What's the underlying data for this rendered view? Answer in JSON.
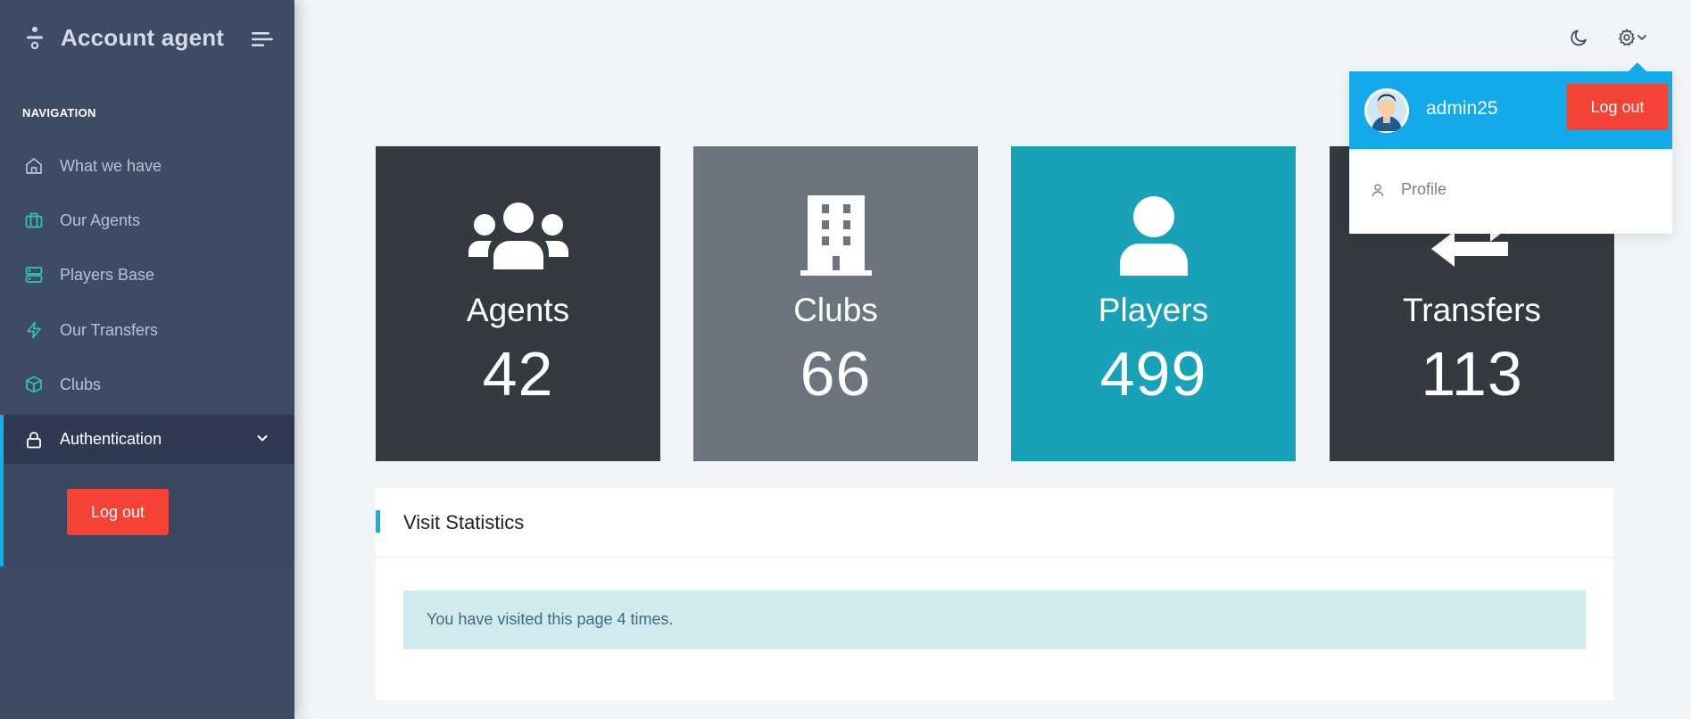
{
  "app": {
    "title": "Account agent"
  },
  "sidebar": {
    "heading": "NAVIGATION",
    "items": [
      {
        "label": "What we have",
        "icon": "home-icon"
      },
      {
        "label": "Our Agents",
        "icon": "briefcase-icon"
      },
      {
        "label": "Players Base",
        "icon": "server-icon"
      },
      {
        "label": "Our Transfers",
        "icon": "lightning-icon"
      },
      {
        "label": "Clubs",
        "icon": "box-icon"
      },
      {
        "label": "Authentication",
        "icon": "lock-icon",
        "active": true
      }
    ],
    "submenu": {
      "logout_label": "Log out"
    }
  },
  "topbar": {
    "theme_icon": "moon-icon",
    "settings_icon": "gear-icon"
  },
  "cards": [
    {
      "title": "Agents",
      "value": "42",
      "color": "#343a40",
      "icon": "users-icon"
    },
    {
      "title": "Clubs",
      "value": "66",
      "color": "#6c757d",
      "icon": "building-icon"
    },
    {
      "title": "Players",
      "value": "499",
      "color": "#17a2b8",
      "icon": "user-icon"
    },
    {
      "title": "Transfers",
      "value": "113",
      "color": "#343a40",
      "icon": "exchange-icon"
    }
  ],
  "panel": {
    "title": "Visit Statistics",
    "message": "You have visited this page 4 times."
  },
  "user_menu": {
    "username": "admin25",
    "logout_label": "Log out",
    "items": [
      {
        "label": "Profile",
        "icon": "user-outline-icon"
      }
    ]
  },
  "colors": {
    "sidebar_bg": "#3e4b65",
    "accent": "#13b0e6",
    "danger": "#f44336",
    "icon_accent": "#2ec4b6"
  }
}
